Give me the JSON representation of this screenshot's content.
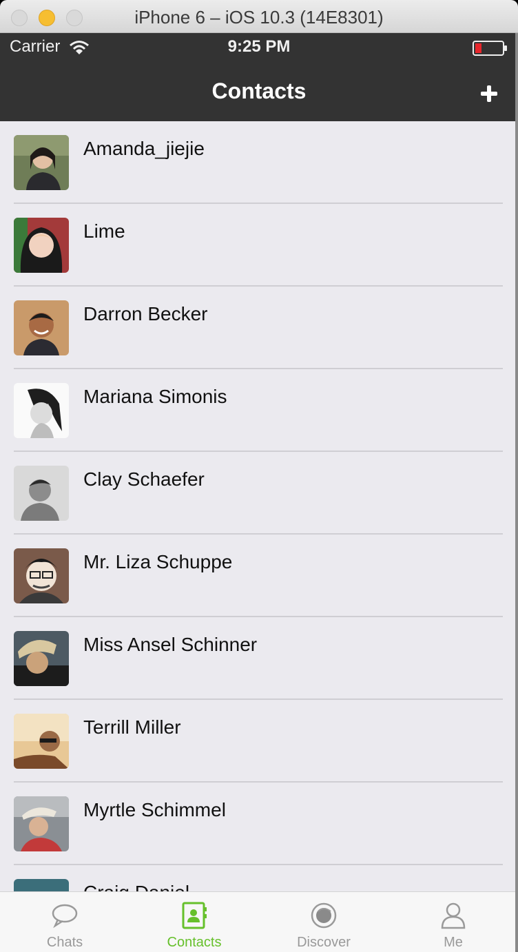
{
  "window": {
    "title": "iPhone 6 – iOS 10.3 (14E8301)"
  },
  "status_bar": {
    "carrier": "Carrier",
    "time": "9:25 PM"
  },
  "nav": {
    "title": "Contacts"
  },
  "contacts": [
    {
      "name": "Amanda_jiejie"
    },
    {
      "name": "Lime"
    },
    {
      "name": "Darron Becker"
    },
    {
      "name": "Mariana Simonis"
    },
    {
      "name": "Clay Schaefer"
    },
    {
      "name": "Mr. Liza Schuppe"
    },
    {
      "name": "Miss Ansel Schinner"
    },
    {
      "name": "Terrill Miller"
    },
    {
      "name": "Myrtle Schimmel"
    },
    {
      "name": "Craig Daniel"
    }
  ],
  "tabs": [
    {
      "label": "Chats",
      "icon": "chat-bubble-icon"
    },
    {
      "label": "Contacts",
      "icon": "contacts-book-icon",
      "active": true
    },
    {
      "label": "Discover",
      "icon": "discover-icon"
    },
    {
      "label": "Me",
      "icon": "person-icon"
    }
  ],
  "colors": {
    "nav_bg": "#333333",
    "accent": "#66c02b",
    "list_bg": "#ebeaef"
  }
}
